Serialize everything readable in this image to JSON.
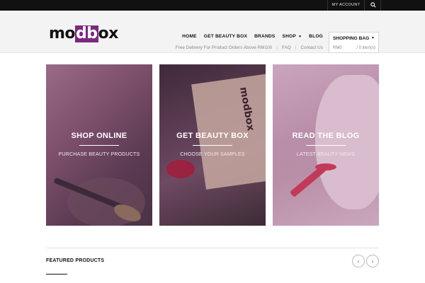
{
  "topbar": {
    "account_label": "MY ACCOUNT",
    "search_icon": "search-icon"
  },
  "header": {
    "logo": {
      "part1": "mo",
      "part2": "db",
      "part3": "ox"
    },
    "nav": [
      {
        "label": "HOME",
        "has_dropdown": false
      },
      {
        "label": "GET BEAUTY BOX",
        "has_dropdown": false
      },
      {
        "label": "BRANDS",
        "has_dropdown": false
      },
      {
        "label": "SHOP",
        "has_dropdown": true
      },
      {
        "label": "BLOG",
        "has_dropdown": false
      }
    ],
    "subnav": {
      "delivery": "Free Delivery For Product Orders Above RM100",
      "faq": "FAQ",
      "contact": "Contact Us",
      "sep": "|"
    },
    "bag": {
      "title": "SHOPPING BAG",
      "amount": "RM0",
      "items": "/ 0 item(s)"
    }
  },
  "tiles": [
    {
      "title": "SHOP ONLINE",
      "subtitle": "PURCHASE BEAUTY PRODUCTS"
    },
    {
      "title": "GET BEAUTY BOX",
      "subtitle": "CHOOSE YOUR SAMPLES"
    },
    {
      "title": "READ THE BLOG",
      "subtitle": "LATEST BEAUTY NEWS"
    }
  ],
  "tile_box_logo": "modbox",
  "featured": {
    "title": "FEATURED PRODUCTS",
    "prev": "‹",
    "next": "›"
  },
  "colors": {
    "brand": "#7a2a7e",
    "topbar": "#111111",
    "header_bg": "#f3f3f3"
  }
}
